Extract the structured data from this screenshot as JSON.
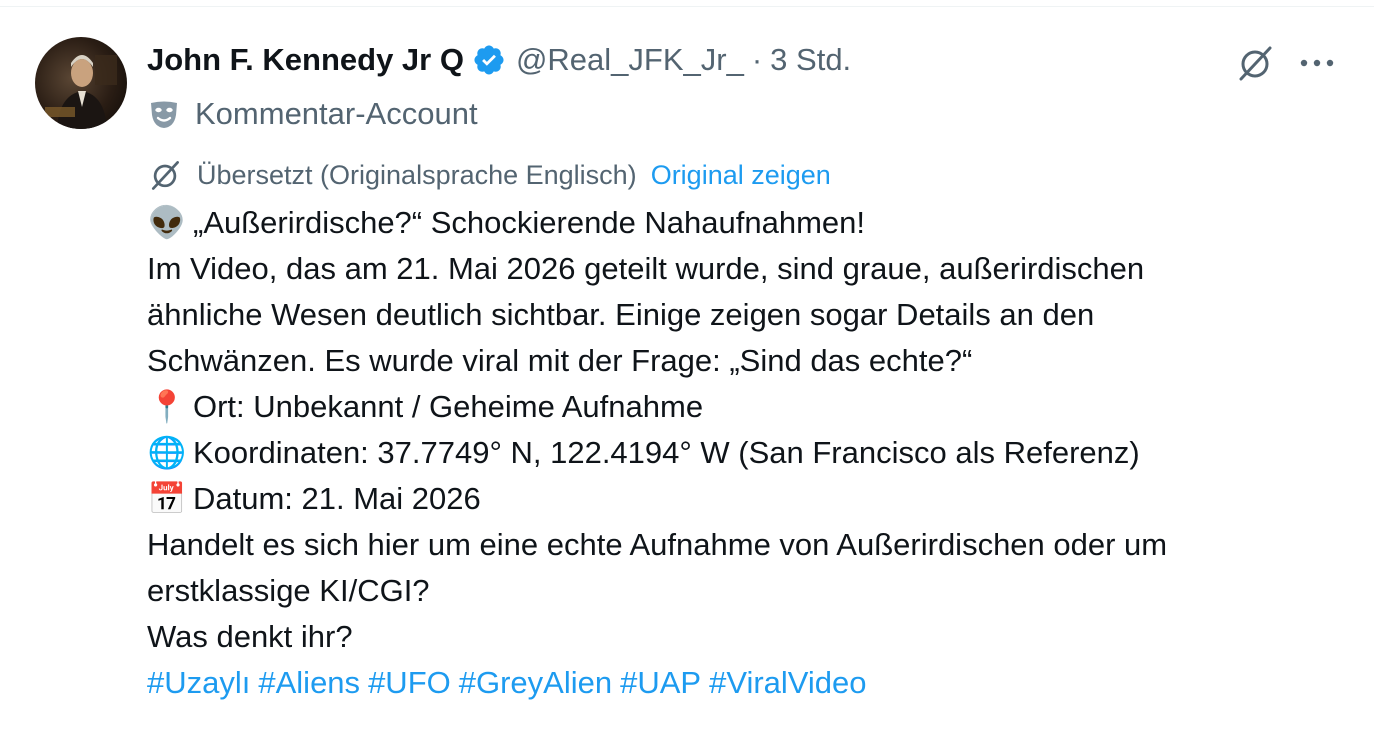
{
  "author": {
    "display_name": "John F. Kennedy Jr Q",
    "handle": "@Real_JFK_Jr_",
    "separator": "·",
    "time": "3 Std.",
    "verified": true,
    "account_label": "Kommentar-Account",
    "account_label_icon": "theater-mask-icon"
  },
  "translation": {
    "notice": "Übersetzt (Originalsprache Englisch)",
    "show_original": "Original zeigen"
  },
  "body": {
    "line1_emoji": "👽",
    "line1": "„Außerirdische?“ Schockierende Nahaufnahmen!",
    "line2": "Im Video, das am 21. Mai 2026 geteilt wurde, sind graue, außerirdischen",
    "line3": "ähnliche Wesen deutlich sichtbar. Einige zeigen sogar Details an den",
    "line4": "Schwänzen. Es wurde viral mit der Frage: „Sind das echte?“",
    "location_emoji": "📍",
    "location": "Ort: Unbekannt / Geheime Aufnahme",
    "coords_emoji": "🌐",
    "coords": "Koordinaten: 37.7749° N, 122.4194° W (San Francisco als Referenz)",
    "date_emoji": "📅",
    "date": "Datum: 21. Mai 2026",
    "question1": "Handelt es sich hier um eine echte Aufnahme von Außerirdischen oder um",
    "question2": "erstklassige KI/CGI?",
    "question3": "Was denkt ihr?"
  },
  "hashtags": [
    "#Uzaylı",
    "#Aliens",
    "#UFO",
    "#GreyAlien",
    "#UAP",
    "#ViralVideo"
  ],
  "colors": {
    "link": "#1d9bf0",
    "secondary_text": "#536471",
    "primary_text": "#0f1419",
    "verified_badge": "#1d9bf0"
  }
}
